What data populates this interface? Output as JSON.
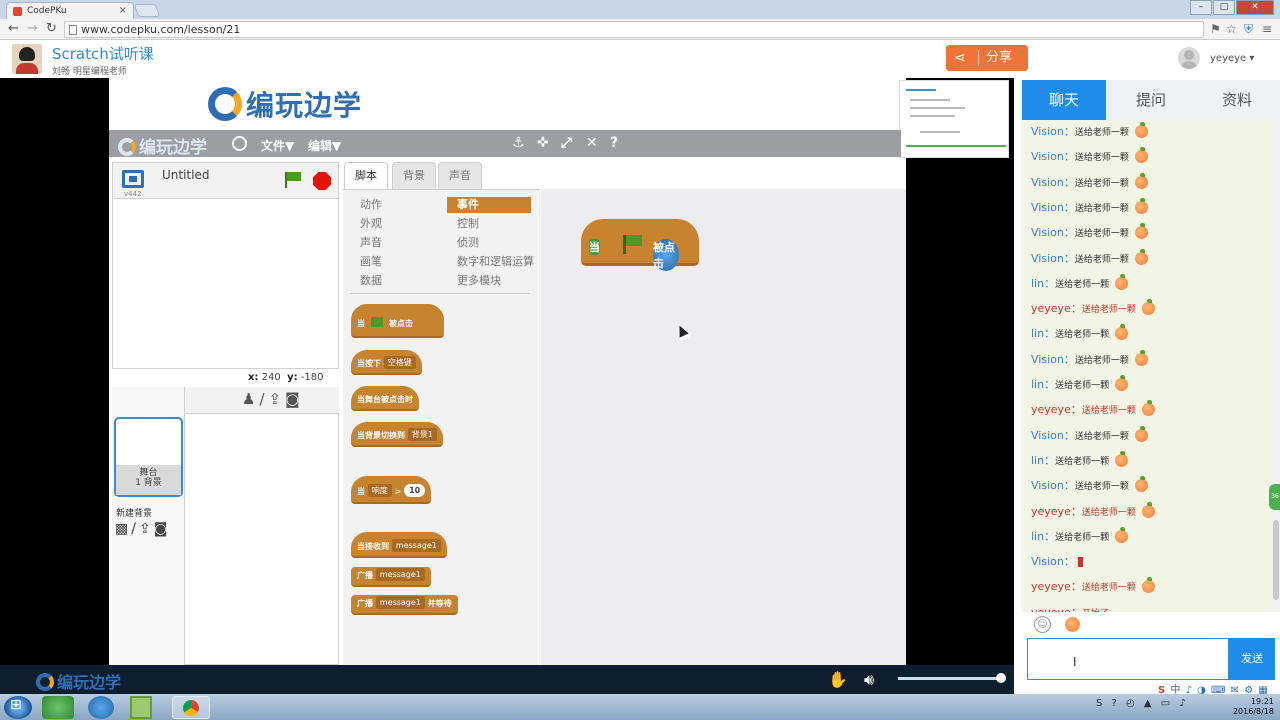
{
  "browser": {
    "tab_title": "CodePKu",
    "tab_close": "×",
    "url": "www.codepku.com/lesson/21",
    "nav": {
      "back": "←",
      "forward": "→",
      "reload": "↻"
    },
    "window_buttons": {
      "minimize": "–",
      "maximize": "□",
      "close": "✕"
    }
  },
  "header": {
    "course_title": "Scratch试听课",
    "teacher": "刘畅  明星编程老师",
    "share_label": "分享",
    "username": "yeyeye ▾"
  },
  "scratch": {
    "brand": "编玩边学",
    "menubar_brand": "编玩边学",
    "menu_file": "文件▼",
    "menu_edit": "编辑▼",
    "project_name": "Untitled",
    "version": "v442",
    "coords_x_label": "x:",
    "coords_x": "240",
    "coords_y_label": "y:",
    "coords_y": "-180",
    "stage_thumb_label": "舞台",
    "stage_thumb_sub": "1 背景",
    "new_backdrop": "新建背景",
    "tabs": [
      "脚本",
      "背景",
      "声音"
    ],
    "categories_left": [
      "动作",
      "外观",
      "声音",
      "画笔",
      "数据"
    ],
    "categories_right": [
      "事件",
      "控制",
      "侦测",
      "数字和逻辑运算",
      "更多模块"
    ],
    "blocks": {
      "when_flag_when": "当",
      "when_flag_clicked": "被点击",
      "when_key": "当按下",
      "key_slot": "空格键",
      "when_stage": "当舞台被点击时",
      "when_backdrop": "当背景切换到",
      "backdrop_slot": "背景1",
      "when_sensor": "当",
      "sensor_slot": "响度",
      "gt": ">",
      "sensor_val": "10",
      "when_receive": "当接收到",
      "msg_slot": "message1",
      "broadcast": "广播",
      "broadcast_wait": "广播",
      "and_wait": "并等待"
    },
    "script_block": {
      "when": "当",
      "clicked": "被点击"
    }
  },
  "player": {
    "brand": "编玩边学",
    "volume_fraction": 1.0
  },
  "chat": {
    "tabs": [
      "聊天",
      "提问",
      "资料"
    ],
    "messages": [
      {
        "name": "Vision",
        "sep": "：",
        "text": "送给老师一颗",
        "self": false,
        "gift": "peach"
      },
      {
        "name": "Vision",
        "sep": "：",
        "text": "送给老师一颗",
        "self": false,
        "gift": "peach"
      },
      {
        "name": "Vision",
        "sep": "：",
        "text": "送给老师一颗",
        "self": false,
        "gift": "peach"
      },
      {
        "name": "Vision",
        "sep": "：",
        "text": "送给老师一颗",
        "self": false,
        "gift": "peach"
      },
      {
        "name": "Vision",
        "sep": "：",
        "text": "送给老师一颗",
        "self": false,
        "gift": "peach"
      },
      {
        "name": "Vision",
        "sep": "：",
        "text": "送给老师一颗",
        "self": false,
        "gift": "peach"
      },
      {
        "name": "lin",
        "sep": "：",
        "text": "送给老师一颗",
        "self": false,
        "gift": "peach"
      },
      {
        "name": "yeyeye",
        "sep": "：",
        "text": "送给老师一颗",
        "self": true,
        "gift": "peach"
      },
      {
        "name": "lin",
        "sep": "：",
        "text": "送给老师一颗",
        "self": false,
        "gift": "peach"
      },
      {
        "name": "Vision",
        "sep": "：",
        "text": "送给老师一颗",
        "self": false,
        "gift": "peach"
      },
      {
        "name": "lin",
        "sep": "：",
        "text": "送给老师一颗",
        "self": false,
        "gift": "peach"
      },
      {
        "name": "yeyeye",
        "sep": "：",
        "text": "送给老师一颗",
        "self": true,
        "gift": "peach"
      },
      {
        "name": "Vision",
        "sep": "：",
        "text": "送给老师一颗",
        "self": false,
        "gift": "peach"
      },
      {
        "name": "lin",
        "sep": "：",
        "text": "送给老师一颗",
        "self": false,
        "gift": "peach"
      },
      {
        "name": "Vision",
        "sep": "：",
        "text": "送给老师一颗",
        "self": false,
        "gift": "peach"
      },
      {
        "name": "yeyeye",
        "sep": "：",
        "text": "送给老师一颗",
        "self": true,
        "gift": "peach"
      },
      {
        "name": "lin",
        "sep": "：",
        "text": "送给老师一颗",
        "self": false,
        "gift": "peach"
      },
      {
        "name": "Vision",
        "sep": "：",
        "text": "",
        "self": false,
        "gift": "rose"
      },
      {
        "name": "yeyeye",
        "sep": "：",
        "text": "送给老师一颗",
        "self": true,
        "gift": "peach"
      },
      {
        "name": "yeyeye",
        "sep": "：",
        "text": "开始了",
        "self": true,
        "gift": ""
      }
    ],
    "send_label": "发送",
    "input_value": ""
  },
  "taskbar": {
    "time": "19:21",
    "date": "2016/8/18",
    "ime": "中 ♪ ◑ ⌨ ✉ ⚙ ▦"
  }
}
